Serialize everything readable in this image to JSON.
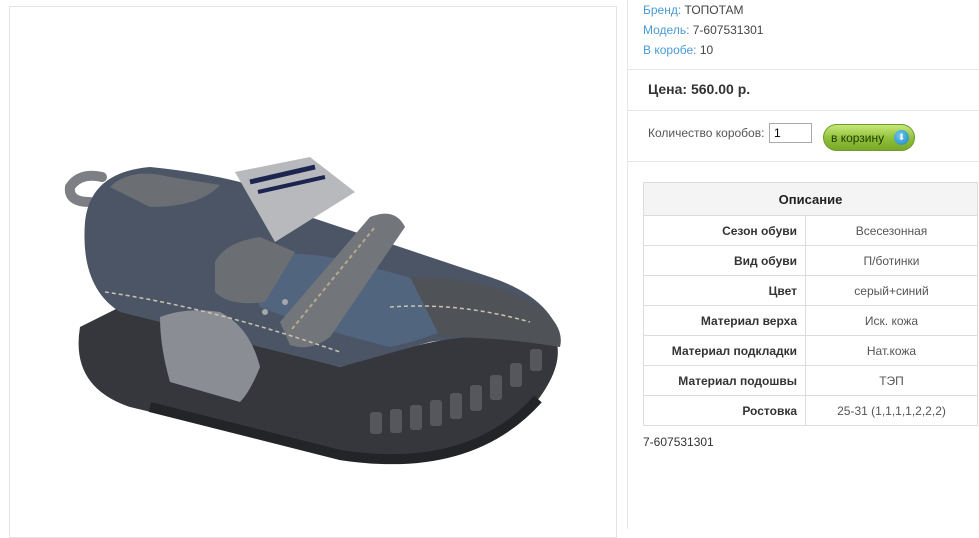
{
  "product": {
    "meta": [
      {
        "label": "Бренд:",
        "value": "ТОПОТАМ"
      },
      {
        "label": "Модель:",
        "value": "7-607531301"
      },
      {
        "label": "В коробе:",
        "value": "10"
      }
    ],
    "price": "Цена: 560.00 р.",
    "quantity": {
      "label": "Количество коробов:",
      "value": "1"
    },
    "cart_button": {
      "label": "в корзину",
      "icon": "cart-arrow-down-icon"
    },
    "description": {
      "title": "Описание",
      "rows": [
        {
          "key": "Сезон обуви",
          "value": "Всесезонная"
        },
        {
          "key": "Вид обуви",
          "value": "П/ботинки"
        },
        {
          "key": "Цвет",
          "value": "серый+синий"
        },
        {
          "key": "Материал верха",
          "value": "Иск. кожа"
        },
        {
          "key": "Материал подкладки",
          "value": "Нат.кожа"
        },
        {
          "key": "Материал подошвы",
          "value": "ТЭП"
        },
        {
          "key": "Ростовка",
          "value": "25-31 (1,1,1,1,2,2,2)"
        }
      ]
    },
    "article": "7-607531301"
  },
  "colors": {
    "link": "#4a9ad4",
    "button": "#8fbf38",
    "icon": "#1e84c0"
  }
}
